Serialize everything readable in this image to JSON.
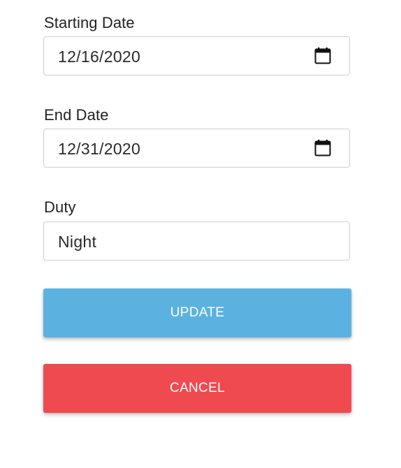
{
  "form": {
    "start_date": {
      "label": "Starting Date",
      "value": "12/16/2020",
      "icon": "calendar-icon"
    },
    "end_date": {
      "label": "End Date",
      "value": "12/31/2020",
      "icon": "calendar-icon"
    },
    "duty": {
      "label": "Duty",
      "value": "Night"
    }
  },
  "buttons": {
    "update_label": "UPDATE",
    "cancel_label": "CANCEL"
  },
  "colors": {
    "update": "#5bb2e0",
    "cancel": "#ee4a50",
    "field_border": "#cfcfcf"
  }
}
